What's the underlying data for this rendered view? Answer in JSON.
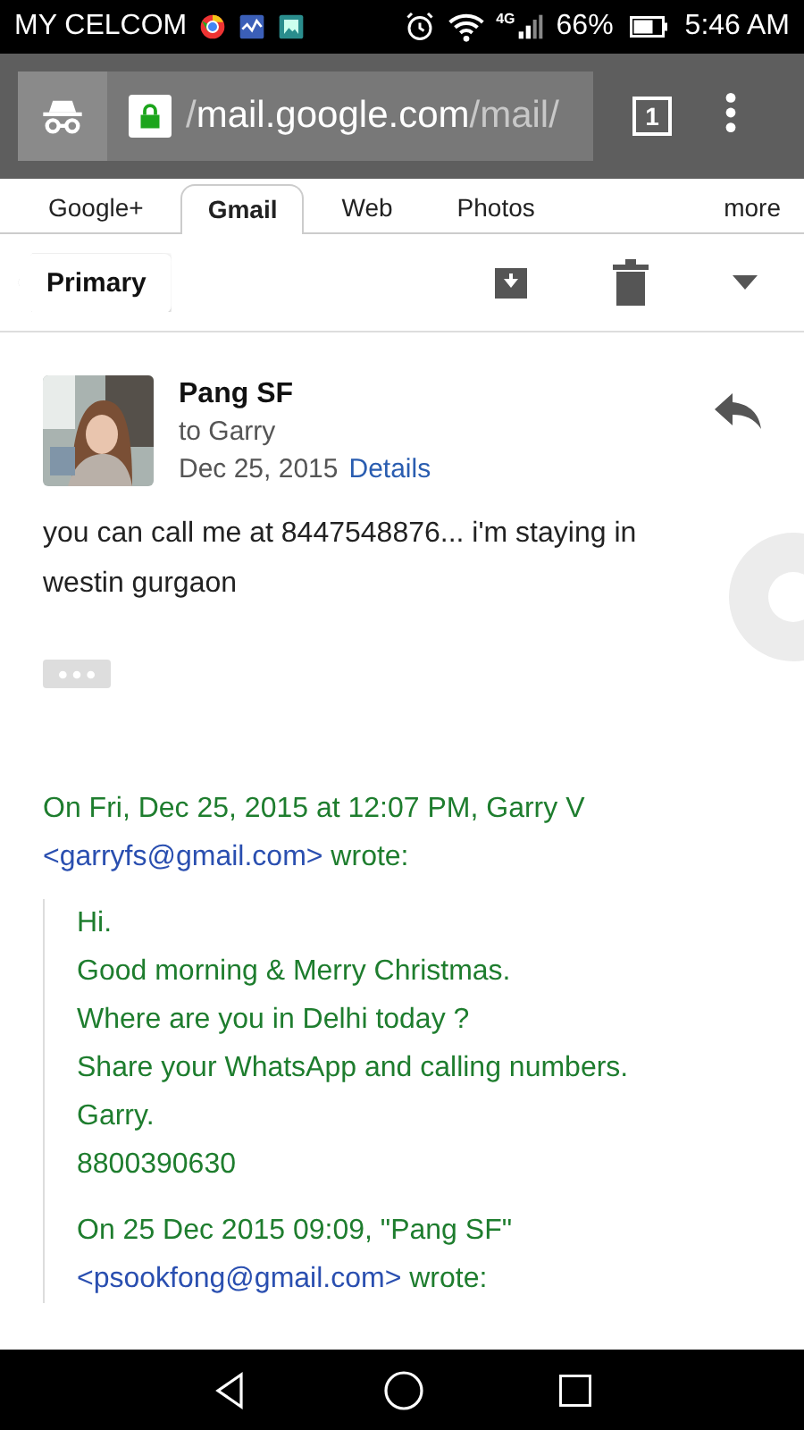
{
  "status_bar": {
    "carrier": "MY CELCOM",
    "network": "4G",
    "battery": "66%",
    "time": "5:46 AM"
  },
  "browser": {
    "url_prefix": "/",
    "url_host": "mail.google.com",
    "url_path": "/mail/",
    "tab_count": "1"
  },
  "google_bar": {
    "tabs": [
      {
        "label": "Google+",
        "selected": false
      },
      {
        "label": "Gmail",
        "selected": true
      },
      {
        "label": "Web",
        "selected": false
      },
      {
        "label": "Photos",
        "selected": false
      },
      {
        "label": "more",
        "selected": false
      }
    ]
  },
  "toolbar": {
    "back_label": "Primary"
  },
  "message": {
    "sender": "Pang SF",
    "recipient": "to Garry",
    "date": "Dec 25, 2015",
    "details_link": "Details",
    "body": "you can call me at 8447548876... i'm staying in westin gurgaon"
  },
  "quote": {
    "header_before": "On Fri, Dec 25, 2015 at 12:07 PM, Garry V",
    "header_email": "<garryfs@gmail.com>",
    "header_after": " wrote:",
    "lines": [
      "Hi.",
      "Good morning & Merry Christmas.",
      "Where are you in Delhi today ?",
      "Share your WhatsApp and calling numbers.",
      "Garry.",
      "8800390630"
    ],
    "nested_header_before": "On 25 Dec 2015 09:09, \"Pang SF\"",
    "nested_header_email": "<psookfong@gmail.com>",
    "nested_header_after": " wrote:"
  }
}
